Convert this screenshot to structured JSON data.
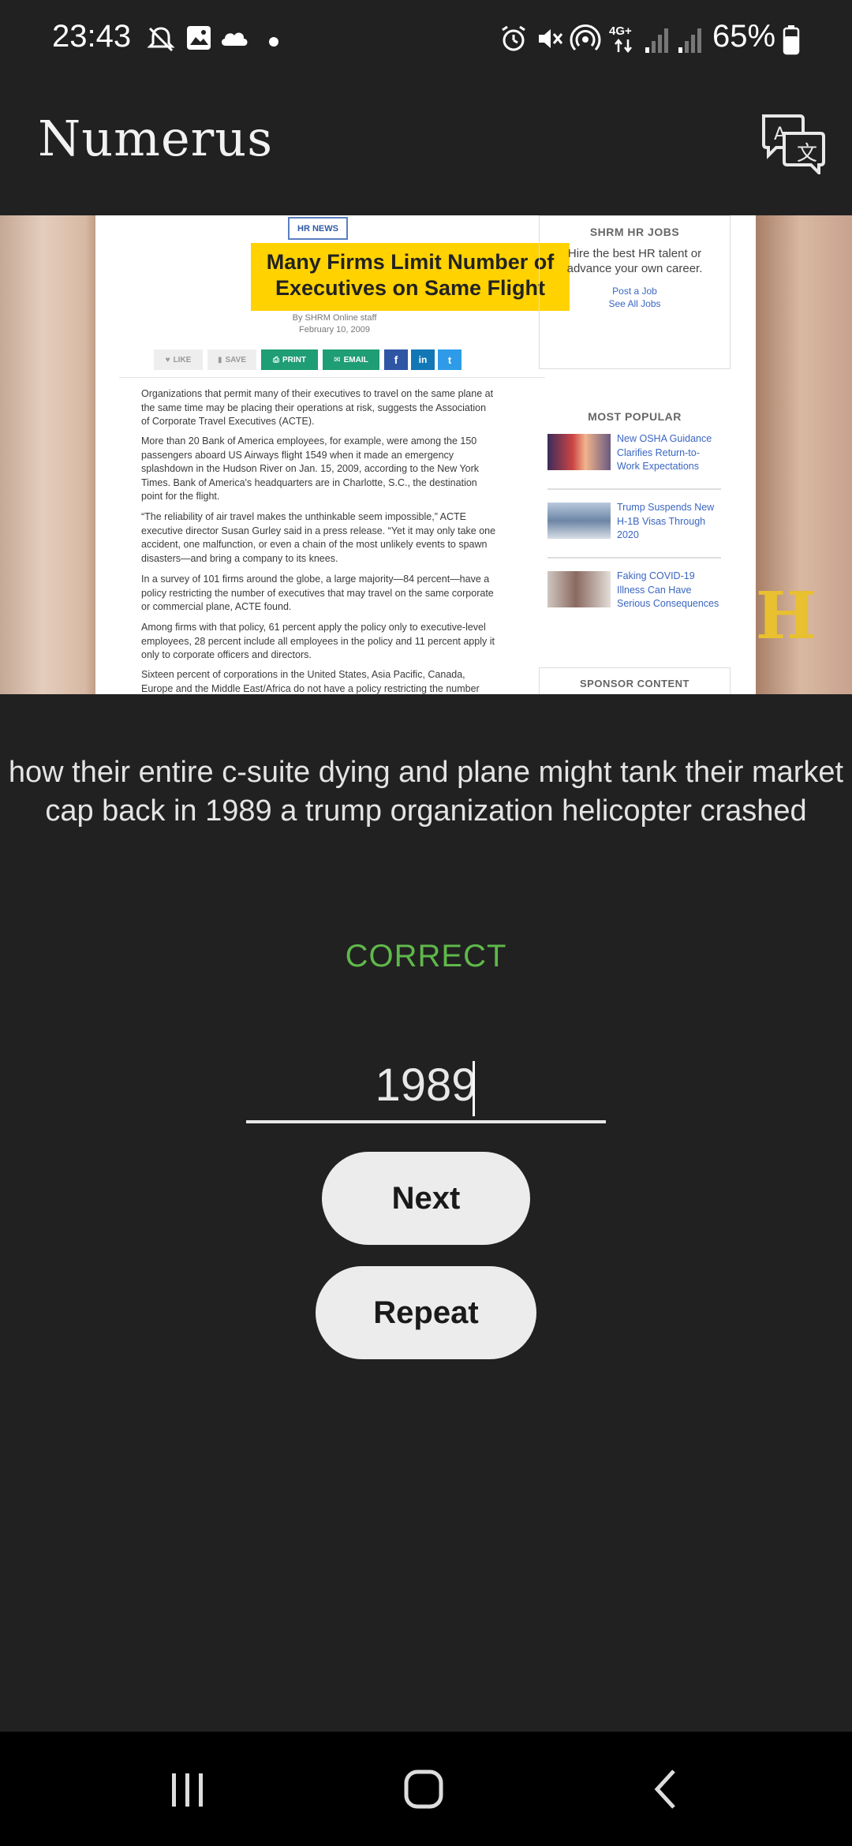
{
  "status_bar": {
    "time": "23:43",
    "network": "4G+",
    "battery": "65%"
  },
  "app": {
    "title": "Numerus",
    "translate_icon": "translate-icon"
  },
  "video": {
    "tag": "HR NEWS",
    "headline": "Many Firms Limit Number of Executives on Same Flight",
    "byline": "By SHRM Online staff",
    "date": "February 10, 2009",
    "share": {
      "like": "LIKE",
      "save": "SAVE",
      "print": "PRINT",
      "email": "EMAIL",
      "facebook": "f",
      "linkedin": "in",
      "twitter": "t"
    },
    "paragraphs": [
      "Organizations that permit many of their executives to travel on the same plane at the same time may be placing their operations at risk, suggests the Association of Corporate Travel Executives (ACTE).",
      "More than 20 Bank of America employees, for example, were among the 150 passengers aboard US Airways flight 1549 when it made an emergency splashdown in the Hudson River on Jan. 15, 2009, according to the New York Times. Bank of America's headquarters are in Charlotte, S.C., the destination point for the flight.",
      "“The reliability of air travel makes the unthinkable seem impossible,” ACTE executive director Susan Gurley said in a press release. “Yet it may only take one accident, one malfunction, or even a chain of the most unlikely events to spawn disasters—and bring a company to its knees.",
      "In a survey of 101 firms around the globe, a large majority—84 percent—have a policy restricting the number of executives that may travel on the same corporate or commercial plane, ACTE found.",
      "Among firms with that policy, 61 percent apply the policy only to executive-level employees, 28 percent include all employees in the policy and 11 percent apply it only to corporate officers and directors.",
      "Sixteen percent of corporations in the United States, Asia Pacific, Canada, Europe and the Middle East/Africa do not have a policy restricting the number"
    ],
    "jobs": {
      "heading": "SHRM HR JOBS",
      "text": "Hire the best HR talent or advance your own career.",
      "post_link": "Post a Job",
      "see_link": "See All Jobs"
    },
    "popular": {
      "heading": "MOST POPULAR",
      "items": [
        "New OSHA Guidance Clarifies Return-to-Work Expectations",
        "Trump Suspends New H-1B Visas Through 2020",
        "Faking COVID-19 Illness Can Have Serious Consequences"
      ]
    },
    "sponsor": "SPONSOR CONTENT"
  },
  "caption": "how their entire c-suite dying and plane might tank their market cap back in 1989 a trump organization helicopter crashed",
  "result": "CORRECT",
  "answer": {
    "value": "1989"
  },
  "buttons": {
    "next": "Next",
    "repeat": "Repeat"
  }
}
